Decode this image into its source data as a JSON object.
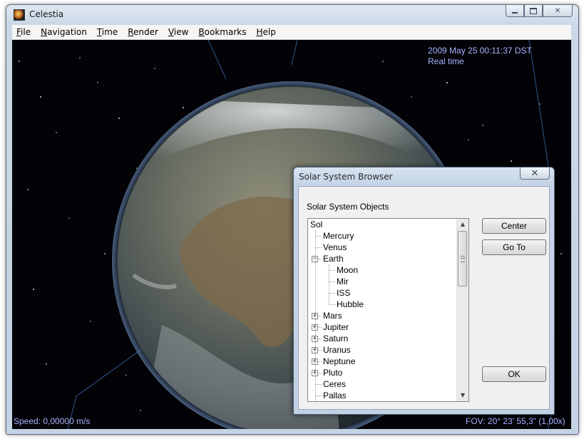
{
  "window": {
    "title": "Celestia",
    "minimize_label": "",
    "maximize_label": "",
    "close_label": "✕"
  },
  "menu": [
    {
      "underline": "F",
      "rest": "ile"
    },
    {
      "underline": "N",
      "rest": "avigation"
    },
    {
      "underline": "T",
      "rest": "ime"
    },
    {
      "underline": "R",
      "rest": "ender"
    },
    {
      "underline": "V",
      "rest": "iew"
    },
    {
      "underline": "B",
      "rest": "ookmarks"
    },
    {
      "underline": "H",
      "rest": "elp"
    }
  ],
  "viewport": {
    "datetime": "2009 May 25 00:11:37 DST",
    "time_mode": "Real time",
    "speed": "Speed: 0,00000 m/s",
    "fov": "FOV: 20° 23' 55,3\" (1,00x)",
    "hud_color": "#a9b3ff"
  },
  "dialog": {
    "title": "Solar System Browser",
    "close_label": "✕",
    "group_label": "Solar System Objects",
    "tree": [
      {
        "label": "Sol",
        "depth": 0,
        "expander": "none"
      },
      {
        "label": "Mercury",
        "depth": 1,
        "expander": "none"
      },
      {
        "label": "Venus",
        "depth": 1,
        "expander": "none"
      },
      {
        "label": "Earth",
        "depth": 1,
        "expander": "minus"
      },
      {
        "label": "Moon",
        "depth": 2,
        "expander": "none"
      },
      {
        "label": "Mir",
        "depth": 2,
        "expander": "none"
      },
      {
        "label": "ISS",
        "depth": 2,
        "expander": "none"
      },
      {
        "label": "Hubble",
        "depth": 2,
        "expander": "none"
      },
      {
        "label": "Mars",
        "depth": 1,
        "expander": "plus"
      },
      {
        "label": "Jupiter",
        "depth": 1,
        "expander": "plus"
      },
      {
        "label": "Saturn",
        "depth": 1,
        "expander": "plus"
      },
      {
        "label": "Uranus",
        "depth": 1,
        "expander": "plus"
      },
      {
        "label": "Neptune",
        "depth": 1,
        "expander": "plus"
      },
      {
        "label": "Pluto",
        "depth": 1,
        "expander": "plus"
      },
      {
        "label": "Ceres",
        "depth": 1,
        "expander": "none"
      },
      {
        "label": "Pallas",
        "depth": 1,
        "expander": "none"
      }
    ],
    "buttons": {
      "center": "Center",
      "goto": "Go To",
      "ok": "OK"
    }
  }
}
